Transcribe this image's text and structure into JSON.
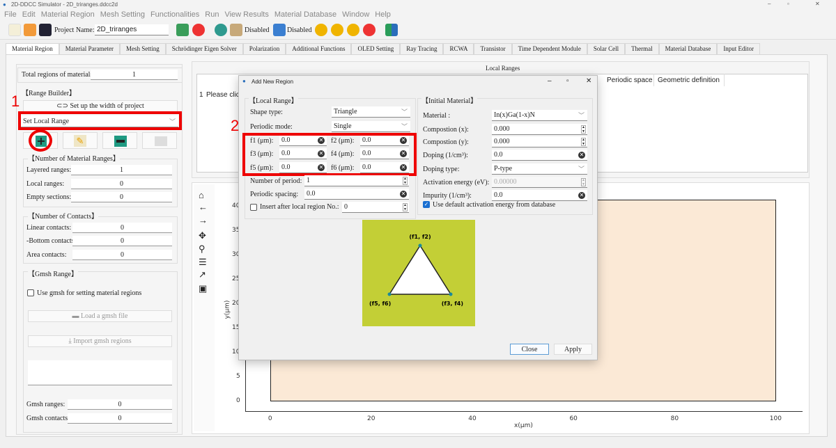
{
  "window": {
    "title": "2D-DDCC Simulator - 2D_triranges.ddcc2d",
    "minimize": "–",
    "maximize": "▫",
    "close": "✕"
  },
  "menu": [
    "File",
    "Edit",
    "Material Region",
    "Mesh Setting",
    "Functionalities",
    "Run",
    "View Results",
    "Material Database",
    "Window",
    "Help"
  ],
  "toolbar": {
    "project_label": "Project Name:",
    "project_name": "2D_triranges",
    "disabled1": "Disabled",
    "disabled2": "Disabled"
  },
  "tabs": [
    "Material Region",
    "Material Parameter",
    "Mesh Setting",
    "Schrödinger Eigen Solver",
    "Polarization",
    "Additional Functions",
    "OLED Setting",
    "Ray Tracing",
    "RCWA",
    "Transistor",
    "Time Dependent Module",
    "Solar Cell",
    "Thermal",
    "Material Database",
    "Input Editor"
  ],
  "left": {
    "total_label": "Total regions of materials:",
    "total_value": "1",
    "range_builder": "【Range Builder】",
    "setup_width": "Set up the width of project",
    "range_combo": "Set Local Range",
    "annot1": "1",
    "material_ranges": {
      "title": "【Number of Material Ranges】",
      "rows": [
        {
          "label": "Layered ranges:",
          "value": "1"
        },
        {
          "label": "Local ranges:",
          "value": "0"
        },
        {
          "label": "Empty sections:",
          "value": "0"
        }
      ]
    },
    "contacts": {
      "title": "【Number of Contacts】",
      "rows": [
        {
          "label": "Linear contacts:",
          "value": "0"
        },
        {
          "label": "-Bottom contacts:",
          "value": "0"
        },
        {
          "label": "Area contacts:",
          "value": "0"
        }
      ]
    },
    "gmsh": {
      "title": "【Gmsh Range】",
      "use_checkbox": "Use gmsh for setting material regions",
      "load": "Load a gmsh file",
      "import": "Import gmsh regions",
      "rows": [
        {
          "label": "Gmsh ranges:",
          "value": "0"
        },
        {
          "label": "Gmsh contacts:",
          "value": "0"
        }
      ]
    }
  },
  "local_ranges": {
    "title": "Local Ranges",
    "columns": [
      "Periodic space",
      "Geometric definition"
    ],
    "row_num": "1",
    "row_text": "Please click"
  },
  "plot": {
    "xlabel": "x(μm)",
    "ylabel": "y(μm)",
    "xticks": [
      "0",
      "20",
      "40",
      "60",
      "80",
      "100"
    ],
    "yticks": [
      "0",
      "5",
      "10",
      "15",
      "20",
      "25",
      "30",
      "35",
      "40"
    ],
    "fill": "#fbe9d6"
  },
  "dialog": {
    "title": "Add New Region",
    "annot2": "2",
    "local": {
      "title": "【Local Range】",
      "shape_label": "Shape type:",
      "shape": "Triangle",
      "periodic_label": "Periodic mode:",
      "periodic": "Single",
      "f": [
        {
          "label": "f1 (μm):",
          "value": "0.0"
        },
        {
          "label": "f2 (μm):",
          "value": "0.0"
        },
        {
          "label": "f3 (μm):",
          "value": "0.0"
        },
        {
          "label": "f4 (μm):",
          "value": "0.0"
        },
        {
          "label": "f5 (μm):",
          "value": "0.0"
        },
        {
          "label": "f6 (μm):",
          "value": "0.0"
        }
      ],
      "nperiod_label": "Number of period:",
      "nperiod": "1",
      "spacing_label": "Periodic spacing:",
      "spacing": "0.0",
      "insert_label": "Insert after local region No.:",
      "insert": "0"
    },
    "material": {
      "title": "【Initial Material】",
      "rows": [
        {
          "label": "Material :",
          "value": "In(x)Ga(1-x)N"
        },
        {
          "label": "Compostion (x):",
          "value": "0.000"
        },
        {
          "label": "Compostion (y):",
          "value": "0.000"
        },
        {
          "label": "Doping (1/cm³):",
          "value": "0.0"
        },
        {
          "label": "Doping type:",
          "value": "P-type"
        },
        {
          "label": "Activation energy (eV):",
          "value": "0.00000"
        },
        {
          "label": "Impurity (1/cm³):",
          "value": "0.0"
        }
      ],
      "use_default": "Use default activation energy from database"
    },
    "diagram": {
      "p12": "(f1, f2)",
      "p34": "(f3, f4)",
      "p56": "(f5, f6)",
      "bg": "#c3cf36"
    },
    "close": "Close",
    "apply": "Apply"
  }
}
